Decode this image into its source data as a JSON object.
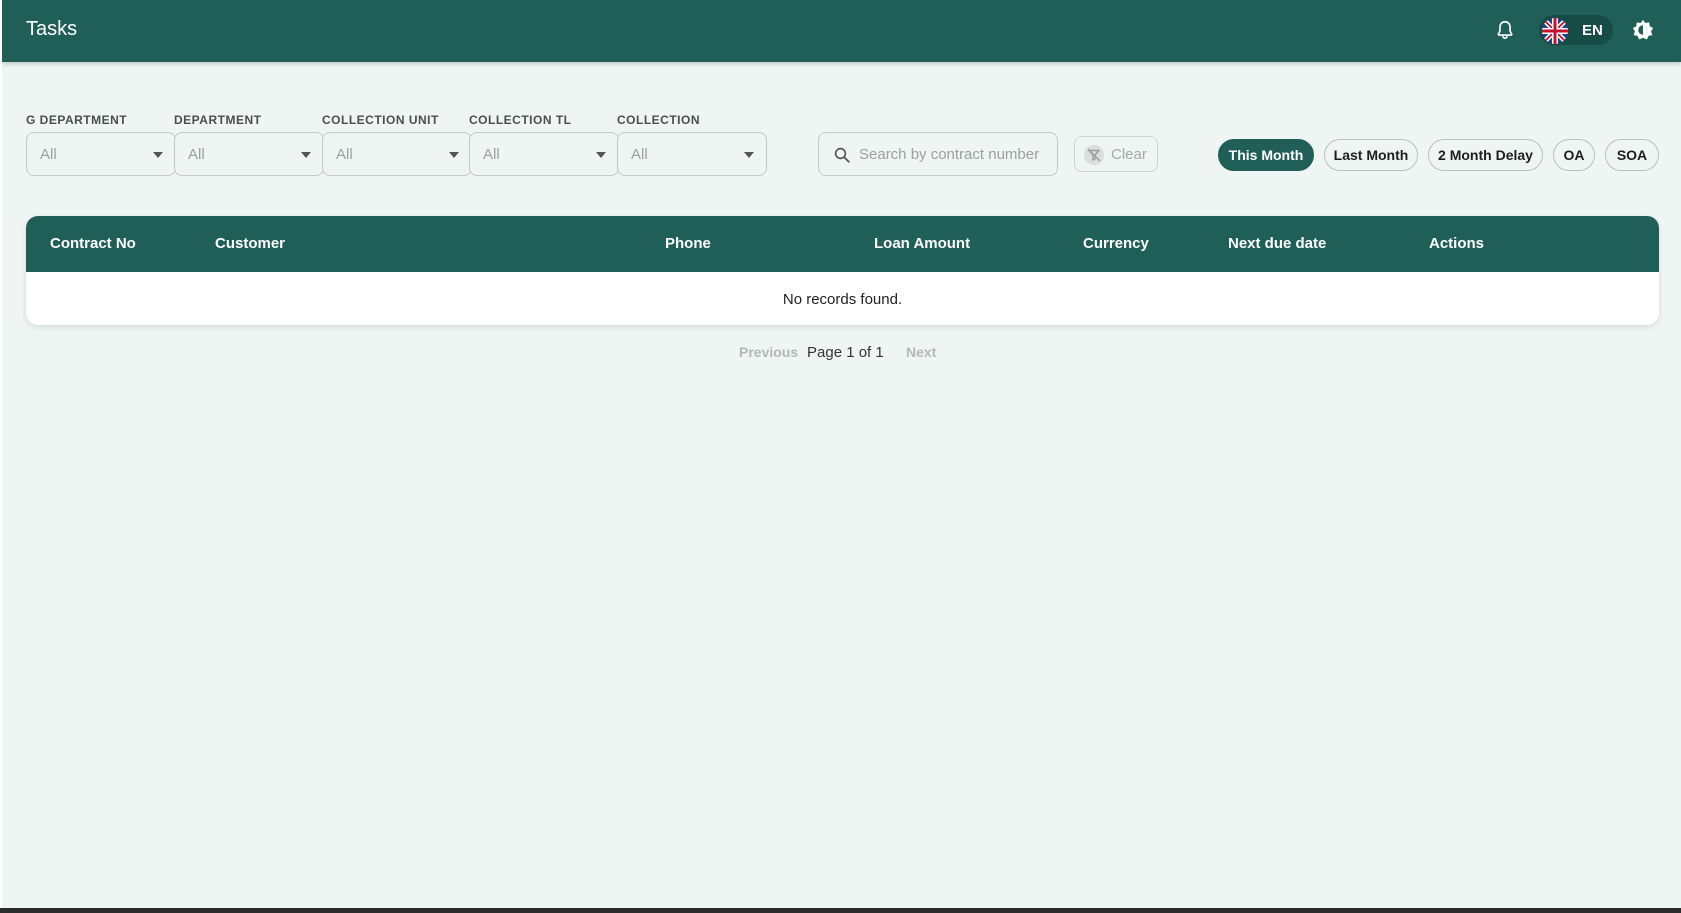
{
  "header": {
    "title": "Tasks",
    "language_code": "EN",
    "bell_icon": "bell-icon",
    "flag_icon": "uk-flag-icon",
    "theme_icon": "brightness-toggle-icon"
  },
  "filters": [
    {
      "label": "G DEPARTMENT",
      "value": "All"
    },
    {
      "label": "DEPARTMENT",
      "value": "All"
    },
    {
      "label": "COLLECTION UNIT",
      "value": "All"
    },
    {
      "label": "COLLECTION TL",
      "value": "All"
    },
    {
      "label": "COLLECTION",
      "value": "All"
    }
  ],
  "search": {
    "placeholder": "Search by contract number",
    "icon": "search-icon"
  },
  "clear_button": {
    "label": "Clear",
    "icon": "filter-clear-icon"
  },
  "period_pills": [
    {
      "label": "This Month",
      "active": true
    },
    {
      "label": "Last Month",
      "active": false
    },
    {
      "label": "2 Month Delay",
      "active": false
    },
    {
      "label": "OA",
      "active": false
    },
    {
      "label": "SOA",
      "active": false
    }
  ],
  "table": {
    "columns": [
      "Contract No",
      "Customer",
      "Phone",
      "Loan Amount",
      "Currency",
      "Next due date",
      "Actions"
    ],
    "empty_message": "No records found."
  },
  "pagination": {
    "previous": "Previous",
    "info": "Page 1 of 1",
    "next": "Next"
  },
  "colors": {
    "primary": "#1f5f57",
    "background": "#eef5f2"
  }
}
